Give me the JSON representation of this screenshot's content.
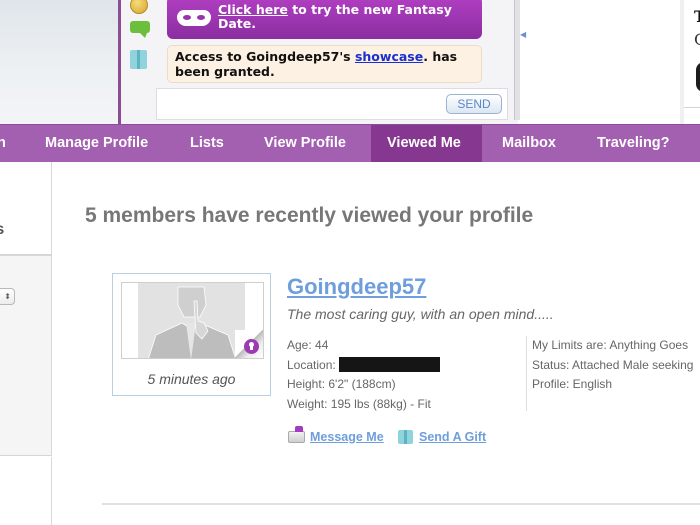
{
  "chat": {
    "fantasy_link": "Click here",
    "fantasy_text": " to try the new Fantasy Date.",
    "access_prefix": "Access to Goingdeep57's ",
    "access_link": "showcase",
    "access_suffix": ". has been granted.",
    "input_placeholder": "",
    "send_label": "SEND",
    "icons": [
      "smiley-icon",
      "chat-bubble-icon",
      "gift-icon"
    ]
  },
  "right_panel": {
    "text_line1": "T",
    "text_line2": "C"
  },
  "nav": {
    "items": [
      {
        "label": "n",
        "active": false
      },
      {
        "label": "Manage Profile",
        "active": false
      },
      {
        "label": "Lists",
        "active": false
      },
      {
        "label": "View Profile",
        "active": false
      },
      {
        "label": "Viewed Me",
        "active": true
      },
      {
        "label": "Mailbox",
        "active": false
      },
      {
        "label": "Traveling?",
        "active": false
      }
    ]
  },
  "sidebar": {
    "title": "ts",
    "select_value": ""
  },
  "main": {
    "title": "5 members have recently viewed your profile",
    "member": {
      "username": "Goingdeep57",
      "tagline": "The most caring guy, with an open mind.....",
      "time_ago": "5 minutes ago",
      "age": "Age: 44",
      "location_label": "Location:",
      "height": "Height: 6'2\" (188cm)",
      "weight": "Weight: 195 lbs (88kg) - Fit",
      "limits": "My Limits are: Anything Goes",
      "status": "Status: Attached Male seeking",
      "profile_lang": "Profile: English",
      "actions": {
        "message": "Message Me",
        "gift": "Send A Gift"
      }
    }
  },
  "colors": {
    "nav_bg": "#a35fb0",
    "nav_active": "#86378f",
    "link": "#6e9edb",
    "fantasy_banner": "#a236b8",
    "access_bg": "#fdf1e3"
  }
}
